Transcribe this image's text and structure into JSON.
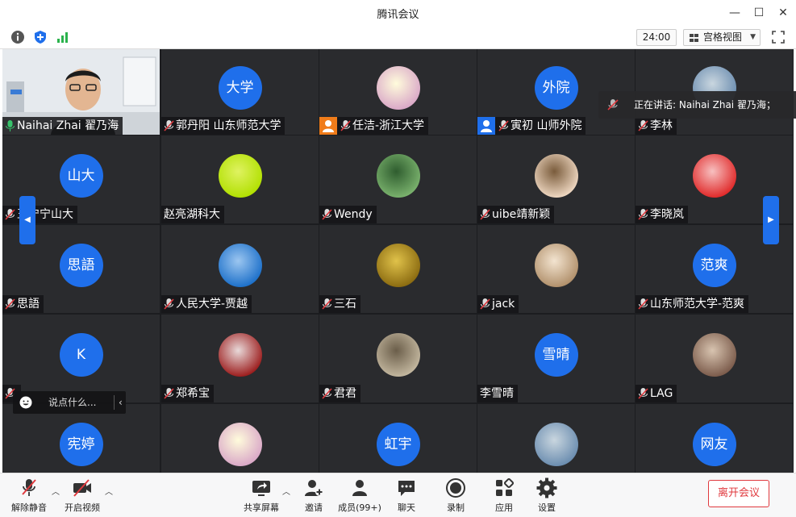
{
  "window": {
    "title": "腾讯会议",
    "minimize": "—",
    "maximize": "☐",
    "close": "✕"
  },
  "topbar": {
    "timer": "24:00",
    "view_label": "宫格视图"
  },
  "speaking_banner": "正在讲话: Naihai Zhai  翟乃海；",
  "chat": {
    "placeholder": "说点什么..."
  },
  "participants": [
    {
      "name": "Naihai Zhai  翟乃海",
      "mic": "on",
      "kind": "video"
    },
    {
      "name": "郭丹阳 山东师范大学",
      "mic": "off",
      "kind": "text",
      "avatar": "大学"
    },
    {
      "name": "任洁-浙江大学",
      "mic": "off",
      "kind": "photo",
      "badge": "orange"
    },
    {
      "name": "寅初 山师外院",
      "mic": "off",
      "kind": "text",
      "avatar": "外院",
      "badge": "blue"
    },
    {
      "name": "李林",
      "mic": "off",
      "kind": "photo"
    },
    {
      "name": "王宁宁山大",
      "mic": "off",
      "kind": "text",
      "avatar": "山大"
    },
    {
      "name": "赵亮湖科大",
      "mic": "none",
      "kind": "photo"
    },
    {
      "name": "Wendy",
      "mic": "off",
      "kind": "photo"
    },
    {
      "name": "uibe靖新颖",
      "mic": "off",
      "kind": "photo"
    },
    {
      "name": "李晓岚",
      "mic": "off",
      "kind": "photo"
    },
    {
      "name": "思語",
      "mic": "off",
      "kind": "text",
      "avatar": "思語"
    },
    {
      "name": "人民大学-贾越",
      "mic": "off",
      "kind": "photo"
    },
    {
      "name": "三石",
      "mic": "off",
      "kind": "photo"
    },
    {
      "name": "jack",
      "mic": "off",
      "kind": "photo"
    },
    {
      "name": "山东师范大学-范爽",
      "mic": "off",
      "kind": "text",
      "avatar": "范爽"
    },
    {
      "name": "",
      "mic": "off",
      "kind": "text",
      "avatar": "K"
    },
    {
      "name": "郑希宝",
      "mic": "off",
      "kind": "photo"
    },
    {
      "name": "君君",
      "mic": "off",
      "kind": "photo"
    },
    {
      "name": "李雪晴",
      "mic": "none",
      "kind": "text",
      "avatar": "雪晴"
    },
    {
      "name": "LAG",
      "mic": "off",
      "kind": "photo"
    },
    {
      "name": "",
      "mic": "none",
      "kind": "text",
      "avatar": "宪婷"
    },
    {
      "name": "",
      "mic": "none",
      "kind": "photo"
    },
    {
      "name": "",
      "mic": "none",
      "kind": "text",
      "avatar": "虹宇"
    },
    {
      "name": "",
      "mic": "none",
      "kind": "photo"
    },
    {
      "name": "",
      "mic": "none",
      "kind": "text",
      "avatar": "网友"
    }
  ],
  "bottombar": {
    "unmute": "解除静音",
    "start_video": "开启视频",
    "share": "共享屏幕",
    "invite": "邀请",
    "members": "成员(99+)",
    "chat": "聊天",
    "record": "录制",
    "apps": "应用",
    "settings": "设置",
    "leave": "离开会议"
  },
  "colors": {
    "avatar_blue": "#1f6feb",
    "leave_red": "#e0393e",
    "speaking_green": "#38c36b"
  }
}
